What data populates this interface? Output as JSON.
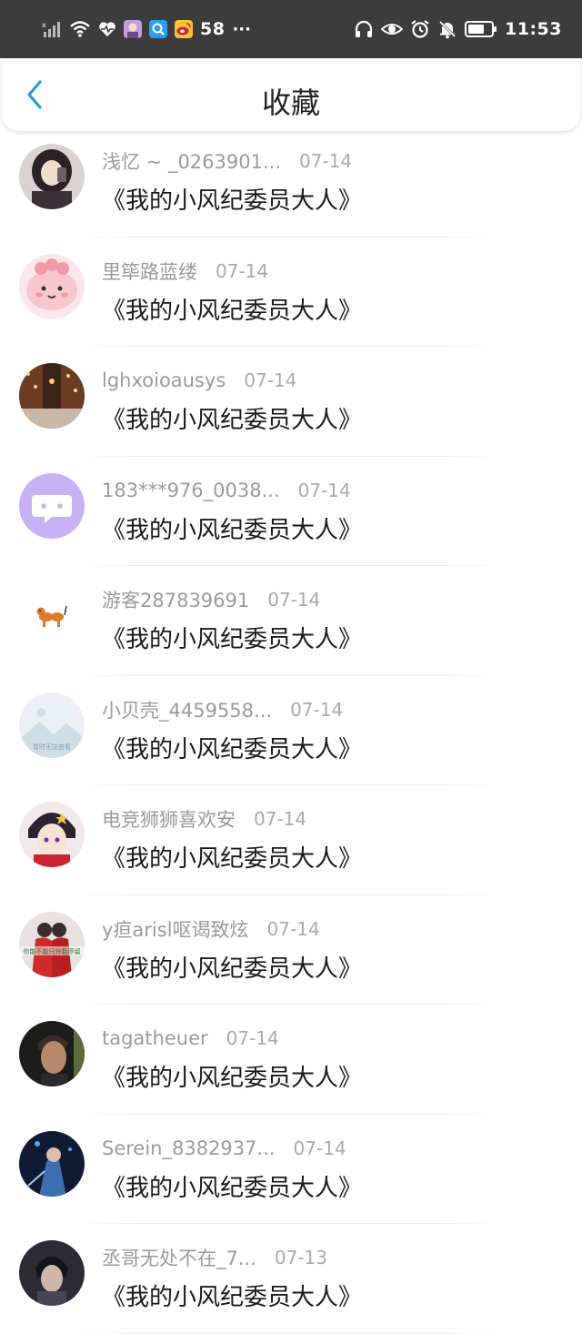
{
  "status_bar": {
    "battery_badge": "58",
    "overflow": "···",
    "time": "11:53",
    "icons": [
      "signal-icon",
      "wifi-icon",
      "health-heart-icon",
      "app-avatar-icon",
      "search-app-icon",
      "weibo-icon",
      "headphones-icon",
      "eye-icon",
      "alarm-icon",
      "mute-icon",
      "battery-icon"
    ]
  },
  "header": {
    "title": "收藏",
    "accent": "#2b9bd6"
  },
  "items": [
    {
      "user": "浅忆 ~ _0263901...",
      "date": "07-14",
      "title": "《我的小风纪委员大人》",
      "avatar": "avatar-girl-photo"
    },
    {
      "user": "里筚路蓝缕",
      "date": "07-14",
      "title": "《我的小风纪委员大人》",
      "avatar": "avatar-pink-cartoon"
    },
    {
      "user": "lghxoioausys",
      "date": "07-14",
      "title": "《我的小风纪委员大人》",
      "avatar": "avatar-night-street"
    },
    {
      "user": "183***976_0038...",
      "date": "07-14",
      "title": "《我的小风纪委员大人》",
      "avatar": "avatar-purple-chat"
    },
    {
      "user": "游客287839691",
      "date": "07-14",
      "title": "《我的小风纪委员大人》",
      "avatar": "avatar-balloon-dog"
    },
    {
      "user": "小贝壳_4459558...",
      "date": "07-14",
      "title": "《我的小风纪委员大人》",
      "avatar": "avatar-placeholder-landscape",
      "avatar_text": "暂时无法查看"
    },
    {
      "user": "电竞狮狮喜欢安",
      "date": "07-14",
      "title": "《我的小风纪委员大人》",
      "avatar": "avatar-anime-boy"
    },
    {
      "user": "y疸arisl呕谒致炫",
      "date": "07-14",
      "title": "《我的小风纪委员大人》",
      "avatar": "avatar-red-couple",
      "avatar_text": "你能不能只许我停留"
    },
    {
      "user": "tagatheuer",
      "date": "07-14",
      "title": "《我的小风纪委员大人》",
      "avatar": "avatar-man-portrait"
    },
    {
      "user": "Serein_8382937...",
      "date": "07-14",
      "title": "《我的小风纪委员大人》",
      "avatar": "avatar-blue-figure"
    },
    {
      "user": "丞哥无处不在_7...",
      "date": "07-13",
      "title": "《我的小风纪委员大人》",
      "avatar": "avatar-dark-figure"
    }
  ]
}
